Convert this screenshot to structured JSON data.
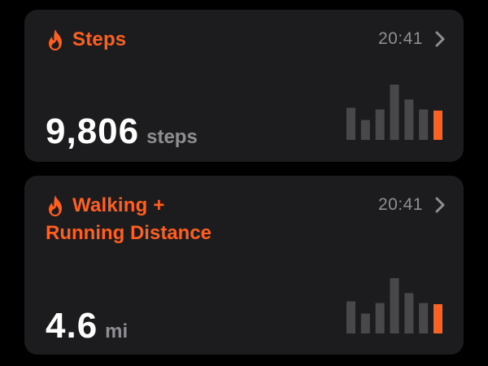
{
  "cards": [
    {
      "title": "Steps",
      "title_line2": "",
      "time": "20:41",
      "value": "9,806",
      "unit": "steps",
      "chart_data": {
        "type": "bar",
        "values": [
          0.58,
          0.36,
          0.55,
          1.0,
          0.73,
          0.55,
          0.53
        ],
        "highlight_index": 6
      }
    },
    {
      "title": "Walking +",
      "title_line2": "Running Distance",
      "time": "20:41",
      "value": "4.6",
      "unit": "mi",
      "chart_data": {
        "type": "bar",
        "values": [
          0.58,
          0.36,
          0.55,
          1.0,
          0.73,
          0.55,
          0.53
        ],
        "highlight_index": 6
      }
    }
  ],
  "icons": {
    "title_icon": "flame-icon",
    "disclosure_icon": "chevron-right-icon"
  },
  "colors": {
    "accent": "#ff5f1f",
    "card_bg": "#1c1c1e",
    "secondary_text": "#8e8e93",
    "bar_inactive": "#48484a",
    "bar_active": "#ff5f1f"
  }
}
